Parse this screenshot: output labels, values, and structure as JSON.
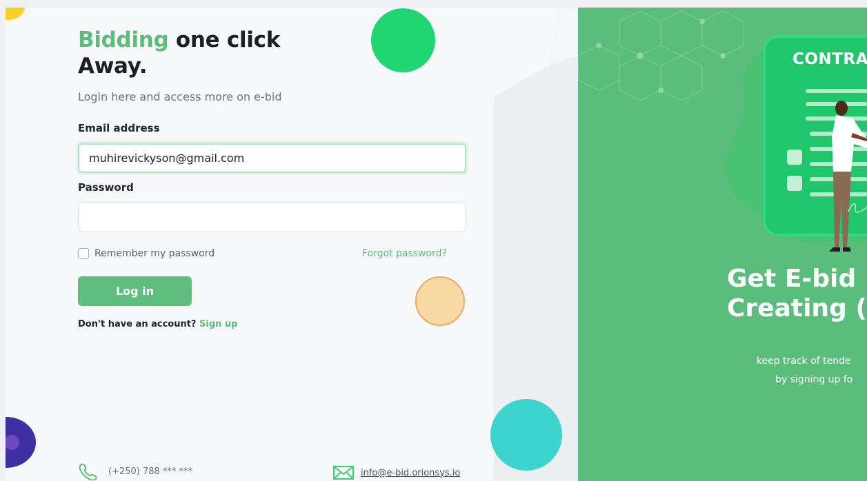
{
  "login": {
    "heading_accent": "Bidding",
    "heading_rest": " one click",
    "heading_line2": "Away.",
    "subtitle": "Login here and access more on e-bid",
    "email_label": "Email address",
    "email_value": "muhirevickyson@gmail.com",
    "password_label": "Password",
    "password_value": "",
    "remember_label": "Remember my password",
    "forgot_label": "Forgot password?",
    "login_button": "Log in",
    "no_account_text": "Don't have an account?",
    "signup_link": "Sign up"
  },
  "footer": {
    "phone": "(+250) 788 *** ***",
    "email": "info@e-bid.orionsys.io"
  },
  "promo": {
    "illustration_title": "CONTRAC",
    "title_line1": "Get E-bid",
    "title_line2": "Creating (",
    "subtitle_line1": "keep track of tende",
    "subtitle_line2": "by signing up fo"
  },
  "colors": {
    "accent": "#5dbb7b",
    "promo_bg": "#5bbd7b",
    "button": "#5fbe7d"
  },
  "icons": {
    "phone": "phone-icon",
    "mail": "mail-icon",
    "checkbox": "checkbox-icon"
  }
}
